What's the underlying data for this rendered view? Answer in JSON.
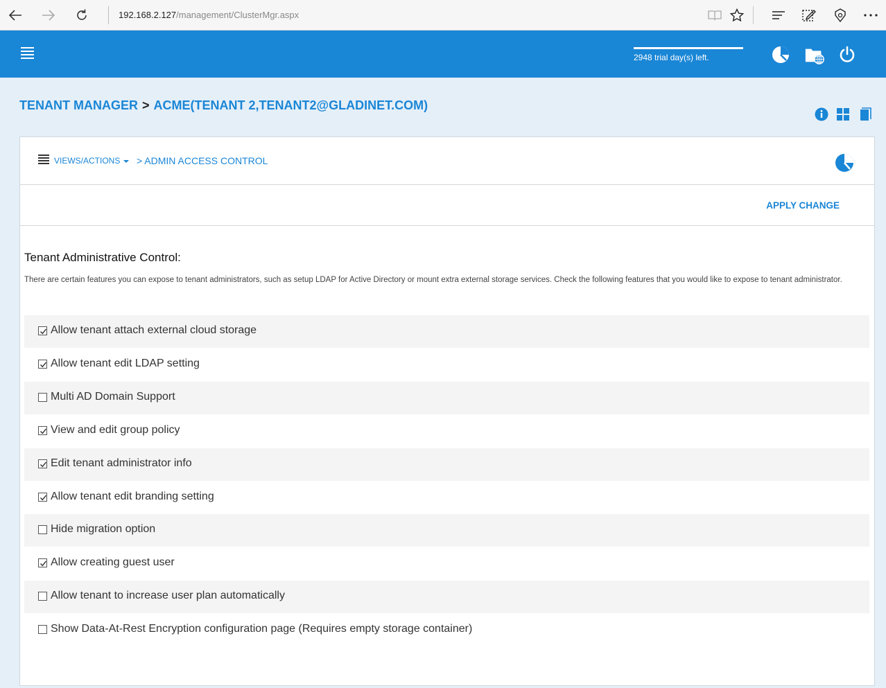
{
  "browser": {
    "address_host": "192.168.2.127",
    "address_path": "/management/ClusterMgr.aspx"
  },
  "header": {
    "trial_text": "2948 trial day(s) left."
  },
  "breadcrumb": {
    "root": "TENANT MANAGER",
    "separator": ">",
    "tenant": "ACME(TENANT 2,TENANT2@GLADINET.COM)"
  },
  "panel": {
    "views_actions": "VIEWS/ACTIONS",
    "page_crumb": "> ADMIN ACCESS CONTROL",
    "apply_label": "APPLY CHANGE",
    "section_title": "Tenant Administrative Control:",
    "section_desc": "There are certain features you can expose to tenant administrators, such as setup LDAP for Active Directory or mount extra external storage services. Check the following features that you would like to expose to tenant administrator.",
    "options": [
      {
        "label": "Allow tenant attach external cloud storage",
        "checked": true
      },
      {
        "label": "Allow tenant edit LDAP setting",
        "checked": true
      },
      {
        "label": "Multi AD Domain Support",
        "checked": false
      },
      {
        "label": "View and edit group policy",
        "checked": true
      },
      {
        "label": "Edit tenant administrator info",
        "checked": true
      },
      {
        "label": "Allow tenant edit branding setting",
        "checked": true
      },
      {
        "label": "Hide migration option",
        "checked": false
      },
      {
        "label": "Allow creating guest user",
        "checked": true
      },
      {
        "label": "Allow tenant to increase user plan automatically",
        "checked": false
      },
      {
        "label": "Show Data-At-Rest Encryption configuration page (Requires empty storage container)",
        "checked": false
      }
    ]
  },
  "colors": {
    "brand_blue": "#1a86d6",
    "page_bg": "#e5eff8"
  }
}
